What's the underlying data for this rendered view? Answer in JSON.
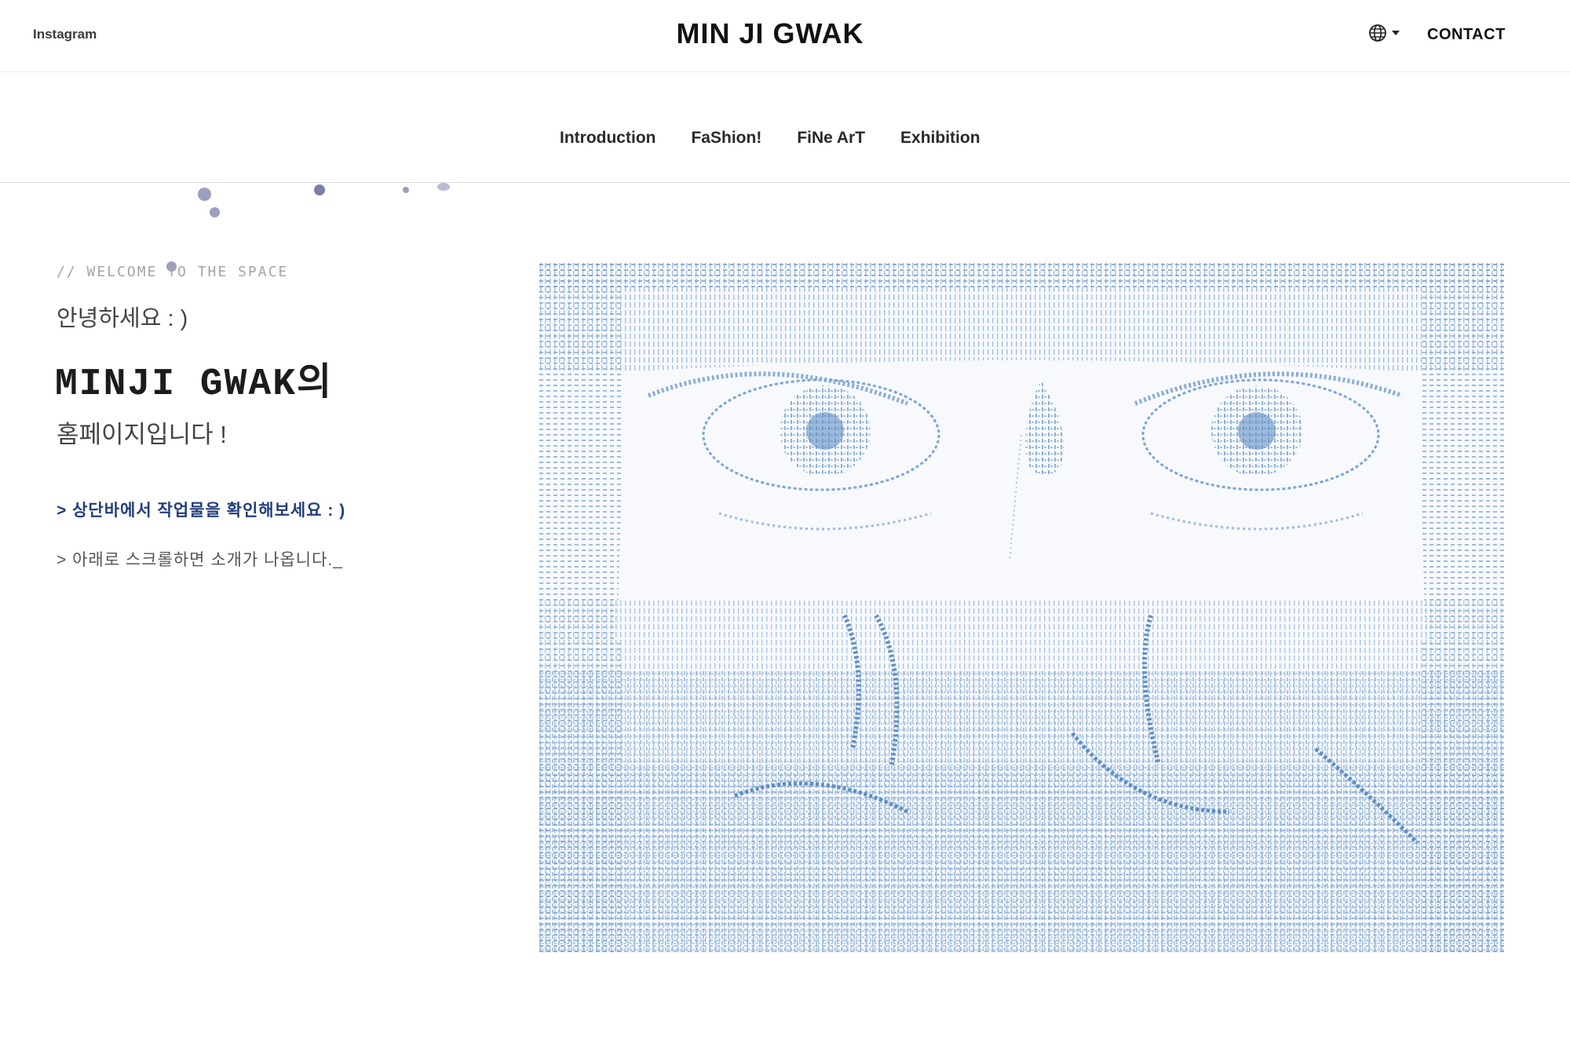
{
  "header": {
    "instagram_label": "Instagram",
    "brand_title": "MIN JI GWAK",
    "language_icon": "globe-icon",
    "contact_label": "CONTACT"
  },
  "nav": {
    "items": [
      {
        "label": "Introduction"
      },
      {
        "label": "FaShion!"
      },
      {
        "label": "FiNe ArT"
      },
      {
        "label": "Exhibition"
      }
    ]
  },
  "intro": {
    "welcome": "// WELCOME TO THE SPACE",
    "greeting": "안녕하세요 : )",
    "name_line": "MINJI GWAK의",
    "homepage_line": "홈페이지입니다 !",
    "hint_top": "> 상단바에서 작업물을 확인해보세요 : )",
    "hint_scroll": "> 아래로 스크롤하면 소개가 나옵니다._"
  },
  "hero_image": {
    "description_icon": "ascii-art-eyes-image"
  },
  "colors": {
    "accent_navy": "#243e7a",
    "ascii_blue": "#6f9ccc",
    "dot_color": "#9c9fbf"
  }
}
